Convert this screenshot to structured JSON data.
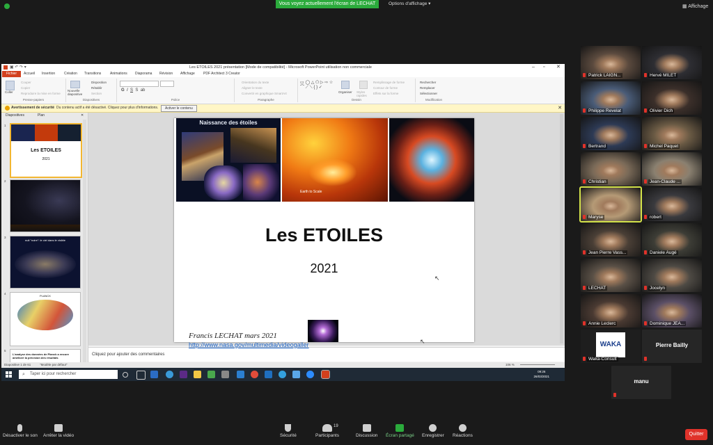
{
  "zoom": {
    "share_banner": "Vous voyez actuellement l'écran de LECHAT",
    "view_options": "Options d'affichage",
    "view_button": "Affichage",
    "controls": {
      "mute": "Désactiver le son",
      "video": "Arrêter la vidéo",
      "security": "Sécurité",
      "participants": "Participants",
      "participants_count": "19",
      "chat": "Discussion",
      "share": "Écran partagé",
      "record": "Enregistrer",
      "reactions": "Réactions",
      "leave": "Quitter"
    },
    "participants": [
      "Patrick LAIGN...",
      "Hervé MILET",
      "Philippe Revelat",
      "Olivier Dich",
      "Bertrand",
      "Michel Paquet",
      "Christian",
      "Jean-Claude ...",
      "Maryse",
      "robert",
      "Jean Pierre Vass...",
      "Daniele Augé",
      "LECHAT",
      "Jocelyn",
      "Annie Leclerc",
      "Dominique JEA...",
      "Waka-Consult",
      "Pierre Bailly",
      "manu"
    ],
    "waka_logo": "WAKA"
  },
  "ppt": {
    "window_title": "Les ETOILES 2021 présentation [Mode de compatibilité] - Microsoft PowerPoint utilisation non commerciale",
    "menu": [
      "Fichier",
      "Accueil",
      "Insertion",
      "Création",
      "Transitions",
      "Animations",
      "Diaporama",
      "Révision",
      "Affichage",
      "PDF Architect 3 Creator"
    ],
    "ribbon": {
      "clipboard": {
        "paste": "Coller",
        "cut": "Couper",
        "copy": "Copier",
        "painter": "Reproduire la mise en forme",
        "label": "Presse-papiers"
      },
      "slides": {
        "new": "Nouvelle diapositive",
        "layout": "Disposition",
        "reset": "Rétablir",
        "section": "Section",
        "label": "Diapositives"
      },
      "font_label": "Police",
      "paragraph": {
        "direction": "Orientation du texte",
        "align": "Aligner le texte",
        "smartart": "Convertir en graphique SmartArt",
        "label": "Paragraphe"
      },
      "drawing": {
        "arrange": "Organiser",
        "styles": "Styles rapides",
        "fill": "Remplissage de forme",
        "outline": "Contour de forme",
        "effects": "Effets sur la forme",
        "label": "Dessin"
      },
      "editing": {
        "find": "Rechercher",
        "replace": "Remplacer",
        "select": "Sélectionner",
        "label": "Modification"
      }
    },
    "security_bar": {
      "title": "Avertissement de sécurité",
      "message": "Du contenu actif a été désactivé. Cliquez pour plus d'informations.",
      "button": "Activer le contenu"
    },
    "panel_tabs": [
      "Diapositives",
      "Plan"
    ],
    "thumbs": [
      {
        "num": "1",
        "title": "Les ETOILES",
        "year": "2021"
      },
      {
        "num": "2"
      },
      {
        "num": "3",
        "caption": "nuit \"noire\": le ciel dans le visible"
      },
      {
        "num": "4",
        "caption": "PLANCK"
      },
      {
        "num": "5",
        "caption": "L'analyse des données de Planck a encore amélioré la précision des résultats"
      }
    ],
    "slide": {
      "banner": "Naissance des étoiles",
      "earth_caption": "Earth to Scale",
      "title": "Les ETOILES",
      "year": "2021",
      "author": "Francis LECHAT mars 2021",
      "link": "http://www.nasa.gov/multimedia/videogaller"
    },
    "notes_placeholder": "Cliquez pour ajouter des commentaires",
    "status": {
      "slide": "Diapositive 1 de 61",
      "theme": "\"Modèle par défaut\"",
      "zoom": "106 %"
    }
  },
  "taskbar": {
    "search_placeholder": "Taper ici pour rechercher",
    "time": "09:26",
    "date": "26/03/2021"
  }
}
